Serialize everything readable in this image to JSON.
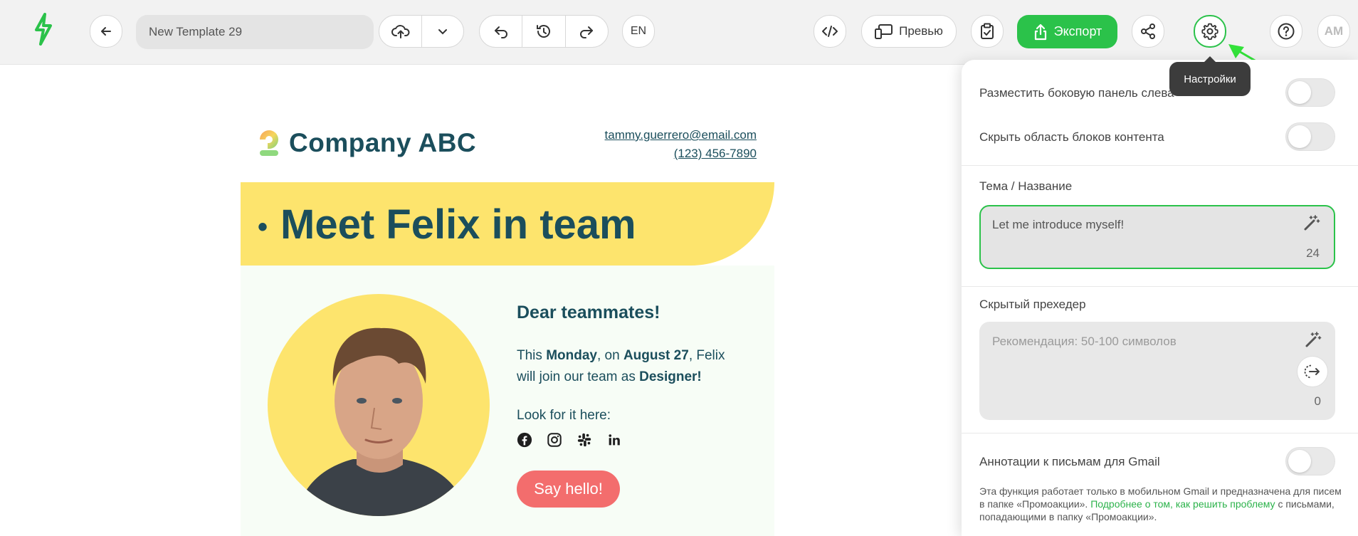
{
  "toolbar": {
    "template_name": "New Template 29",
    "language": "EN",
    "preview_label": "Превью",
    "export_label": "Экспорт",
    "user_initials": "AM"
  },
  "email": {
    "brand_name": "Company ABC",
    "contact_email": "tammy.guerrero@email.com",
    "contact_phone": "(123) 456-7890",
    "hero_title": "Meet Felix in team",
    "greeting": "Dear teammates!",
    "para_1": "This ",
    "para_day": "Monday",
    "para_2": ",  on ",
    "para_date": "August 27",
    "para_3": ", Felix will join our team as ",
    "para_role": "Designer!",
    "look_for": "Look for it here:",
    "button_label": "Say hello!"
  },
  "settings": {
    "tooltip": "Настройки",
    "sidebar_left_label": "Разместить боковую панель слева",
    "hide_blocks_label": "Скрыть область блоков контента",
    "subject_label": "Тема / Название",
    "subject_value": "Let me introduce myself!",
    "subject_count": "24",
    "preheader_label": "Скрытый прехедер",
    "preheader_placeholder": "Рекомендация: 50-100 символов",
    "preheader_count": "0",
    "gmail_label": "Аннотации к письмам для Gmail",
    "note_1": "Эта функция работает только в мобильном Gmail и предназначена для писем в папке «Промоакции». ",
    "note_link": "Подробнее о том, как решить проблему",
    "note_2": " с письмами, попадающими в папку «Промоакции».",
    "toggles": {
      "sidebar_left": false,
      "hide_blocks": false,
      "gmail": false
    }
  },
  "colors": {
    "accent": "#2bc24a",
    "brand_dark": "#1b4e5c",
    "hero_yellow": "#fde46d",
    "button_coral": "#f36d6d"
  }
}
